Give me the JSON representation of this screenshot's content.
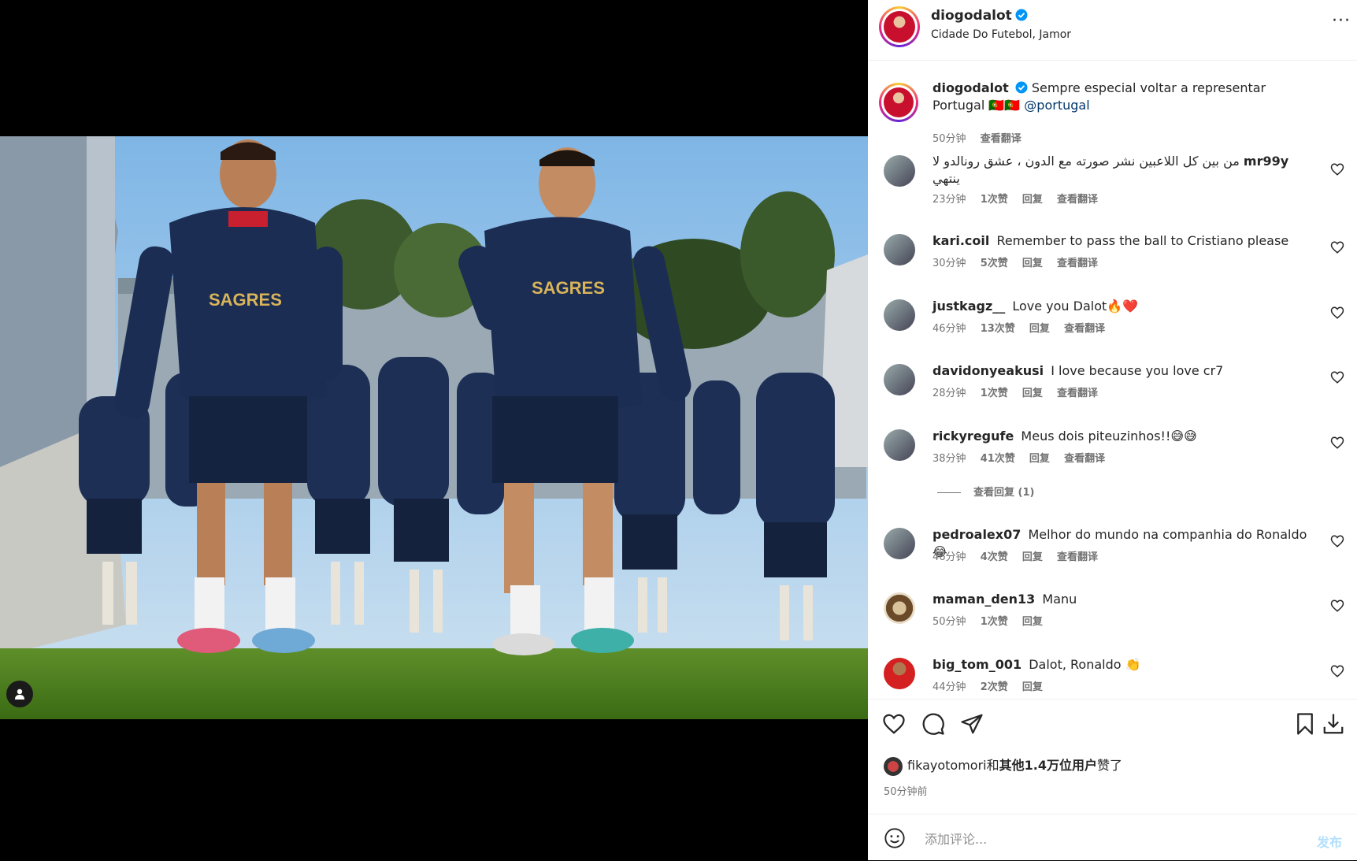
{
  "post": {
    "author": "diogodalot",
    "location": "Cidade Do Futebol, Jamor",
    "more_label": "···",
    "caption_author": "diogodalot",
    "caption_text": "Sempre especial voltar a representar Portugal 🇵🇹🇵🇹",
    "caption_mention": "@portugal",
    "caption_time": "50分钟",
    "caption_translate": "查看翻译"
  },
  "comments": [
    {
      "user": "mr99y",
      "text": "من بين كل اللاعبين نشر صورته مع الدون ، عشق رونالدو لا ينتهي",
      "time": "23分钟",
      "likes": "1次赞",
      "reply": "回复",
      "translate": "查看翻译"
    },
    {
      "user": "kari.coil",
      "text": "Remember to pass the ball to Cristiano please",
      "time": "30分钟",
      "likes": "5次赞",
      "reply": "回复",
      "translate": "查看翻译"
    },
    {
      "user": "justkagz__",
      "text": "Love you Dalot🔥❤️",
      "time": "46分钟",
      "likes": "13次赞",
      "reply": "回复",
      "translate": "查看翻译"
    },
    {
      "user": "davidonyeakusi",
      "text": "I love because you love cr7",
      "time": "28分钟",
      "likes": "1次赞",
      "reply": "回复",
      "translate": "查看翻译"
    },
    {
      "user": "rickyregufe",
      "text": "Meus dois piteuzinhos!!😅😅",
      "time": "38分钟",
      "likes": "41次赞",
      "reply": "回复",
      "translate": "查看翻译",
      "view_replies": "查看回复 (1)"
    },
    {
      "user": "pedroalex07",
      "text": "Melhor do mundo na companhia do Ronaldo 😂",
      "time": "46分钟",
      "likes": "4次赞",
      "reply": "回复",
      "translate": "查看翻译"
    },
    {
      "user": "maman_den13",
      "text": "Manu",
      "time": "50分钟",
      "likes": "1次赞",
      "reply": "回复"
    },
    {
      "user": "big_tom_001",
      "text": "Dalot, Ronaldo 👏",
      "time": "44分钟",
      "likes": "2次赞",
      "reply": "回复"
    }
  ],
  "likes_line": {
    "user": "fikayotomori",
    "conj": "和",
    "others": "其他1.4万位用户",
    "suffix": "赞了"
  },
  "post_time": "50分钟前",
  "comment_box": {
    "placeholder": "添加评论...",
    "post_label": "发布"
  },
  "icons": {
    "like": "heart-icon",
    "comment": "comment-icon",
    "share": "share-icon",
    "save": "bookmark-icon",
    "download": "download-icon",
    "emoji": "emoji-icon",
    "tag": "user-tag-icon",
    "verified": "verified-badge-icon"
  },
  "colors": {
    "verified": "#0095f6",
    "mention": "#00376b",
    "post_button": "#b2dffc"
  }
}
